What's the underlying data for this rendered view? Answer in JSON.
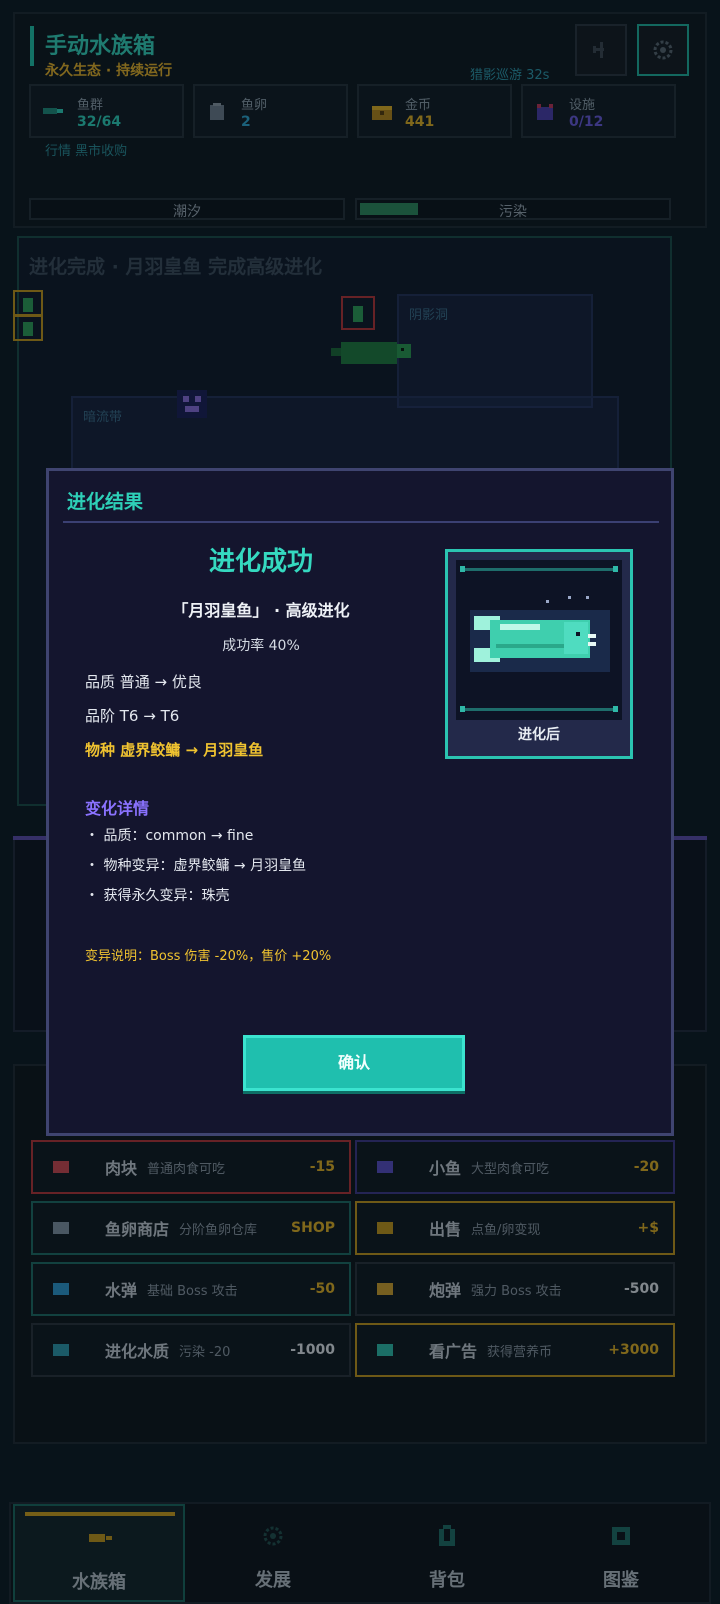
{
  "header": {
    "title": "手动水族箱",
    "subtitle": "永久生态 · 持续运行",
    "patrol": "猎影巡游 32s",
    "market_link": "行情 黑市收购",
    "stats": [
      {
        "label": "鱼群",
        "value": "32/64",
        "color": "#2fd3bd",
        "icon": "fish-school-icon"
      },
      {
        "label": "鱼卵",
        "value": "2",
        "color": "#2fa8d3",
        "icon": "egg-icon"
      },
      {
        "label": "金币",
        "value": "441",
        "color": "#e6b425",
        "icon": "coin-chest-icon"
      },
      {
        "label": "设施",
        "value": "0/12",
        "color": "#6a5be0",
        "icon": "facility-icon"
      }
    ],
    "meters": [
      {
        "label": "潮汐",
        "fill": 0.0
      },
      {
        "label": "污染",
        "fill": 0.19
      }
    ]
  },
  "tank": {
    "banner": "进化完成 · 月羽皇鱼 完成高级进化",
    "zones": [
      "阴影洞",
      "暗流带"
    ]
  },
  "dialog": {
    "title": "进化结果",
    "result": "进化成功",
    "evolution": "「月羽皇鱼」 · 高级进化",
    "success_rate": "成功率 40%",
    "quality": "品质 普通 → 优良",
    "tier": "品阶 T6 → T6",
    "species": "物种 虚界鲛鳙 → 月羽皇鱼",
    "details_title": "变化详情",
    "details": [
      "・ 品质：common → fine",
      "・ 物种变异：虚界鲛鳙 → 月羽皇鱼",
      "・ 获得永久变异：珠壳"
    ],
    "mutation_note": "变异说明：Boss 伤害 -20%，售价 +20%",
    "preview_label": "进化后",
    "confirm": "确认"
  },
  "actions": [
    {
      "name": "肉块",
      "desc": "普通肉食可吃",
      "cost": "-15",
      "border": "#b8353a",
      "cost_color": "#e6b425",
      "icon_color": "#d04a52"
    },
    {
      "name": "小鱼",
      "desc": "大型肉食可吃",
      "cost": "-20",
      "border": "#3f3a8c",
      "cost_color": "#e6b425",
      "icon_color": "#5a4fc8"
    },
    {
      "name": "鱼卵商店",
      "desc": "分阶鱼卵仓库",
      "cost": "SHOP",
      "border": "#1e6e66",
      "cost_color": "#e6b425",
      "icon_color": "#8496a6"
    },
    {
      "name": "出售",
      "desc": "点鱼/卵变现",
      "cost": "+$",
      "border": "#c59a1c",
      "cost_color": "#e6b425",
      "icon_color": "#c59a1c"
    },
    {
      "name": "水弹",
      "desc": "基础 Boss 攻击",
      "cost": "-50",
      "border": "#1e6e66",
      "cost_color": "#e6b425",
      "icon_color": "#2f9bd3"
    },
    {
      "name": "炮弹",
      "desc": "强力 Boss 攻击",
      "cost": "-500",
      "border": "#2a333d",
      "cost_color": "#e8edf3",
      "icon_color": "#d3a52f"
    },
    {
      "name": "进化水质",
      "desc": "污染 -20",
      "cost": "-1000",
      "border": "#2a333d",
      "cost_color": "#e8edf3",
      "icon_color": "#2f9bb0"
    },
    {
      "name": "看广告",
      "desc": "获得营养币",
      "cost": "+3000",
      "border": "#c59a1c",
      "cost_color": "#e6b425",
      "icon_color": "#2fbfae"
    }
  ],
  "nav": [
    {
      "label": "水族箱",
      "icon": "tank-icon",
      "active": true
    },
    {
      "label": "发展",
      "icon": "gear-icon",
      "active": false
    },
    {
      "label": "背包",
      "icon": "backpack-icon",
      "active": false
    },
    {
      "label": "图鉴",
      "icon": "codex-icon",
      "active": false
    }
  ]
}
